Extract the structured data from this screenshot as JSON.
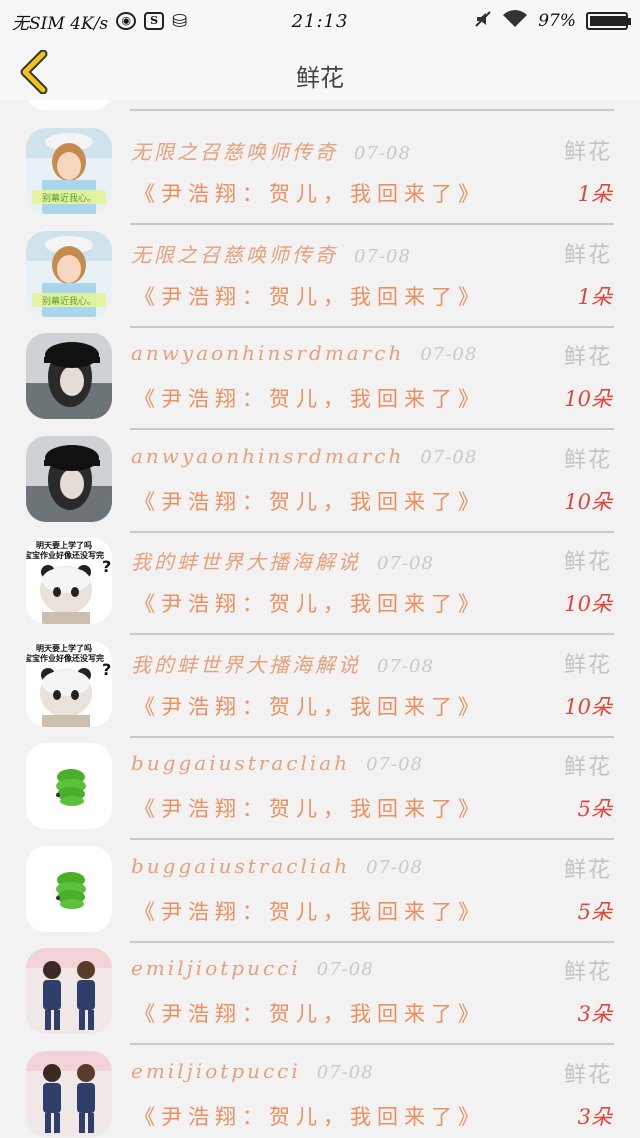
{
  "status_bar": {
    "carrier": "无SIM 4K/s",
    "time": "21:13",
    "battery": "97%",
    "battery_level": 0.97,
    "icons": [
      "globe-icon",
      "s-app-icon",
      "database-icon",
      "mute-icon",
      "wifi-icon",
      "battery-icon"
    ]
  },
  "header": {
    "title": "鲜花",
    "back_icon": "chevron-left-icon",
    "accent": "#f0c21a"
  },
  "colors": {
    "sender": "#e8a07a",
    "message": "#ef8f5e",
    "quantity": "#e0463b",
    "date": "#c9c9c9",
    "gift_label": "#c4c4c4"
  },
  "records": [
    {
      "avatar": "girl-cap-avatar",
      "sender": "无限之召慈唤师传奇",
      "date": "07-08",
      "gift": "鲜花",
      "message": "《尹浩翔：贺儿，我回来了》",
      "quantity": "1朵"
    },
    {
      "avatar": "girl-cap-avatar",
      "sender": "无限之召慈唤师传奇",
      "date": "07-08",
      "gift": "鲜花",
      "message": "《尹浩翔：贺儿，我回来了》",
      "quantity": "1朵"
    },
    {
      "avatar": "black-cap-avatar",
      "sender": "anwyaonhinsrdmarch",
      "date": "07-08",
      "gift": "鲜花",
      "message": "《尹浩翔：贺儿，我回来了》",
      "quantity": "10朵"
    },
    {
      "avatar": "black-cap-avatar",
      "sender": "anwyaonhinsrdmarch",
      "date": "07-08",
      "gift": "鲜花",
      "message": "《尹浩翔：贺儿，我回来了》",
      "quantity": "10朵"
    },
    {
      "avatar": "panda-meme-avatar",
      "sender": "我的蚌世界大播海解说",
      "date": "07-08",
      "gift": "鲜花",
      "message": "《尹浩翔：贺儿，我回来了》",
      "quantity": "10朵"
    },
    {
      "avatar": "panda-meme-avatar",
      "sender": "我的蚌世界大播海解说",
      "date": "07-08",
      "gift": "鲜花",
      "message": "《尹浩翔：贺儿，我回来了》",
      "quantity": "10朵"
    },
    {
      "avatar": "green-worm-avatar",
      "sender": "buggaiustracliah",
      "date": "07-08",
      "gift": "鲜花",
      "message": "《尹浩翔：贺儿，我回来了》",
      "quantity": "5朵"
    },
    {
      "avatar": "green-worm-avatar",
      "sender": "buggaiustracliah",
      "date": "07-08",
      "gift": "鲜花",
      "message": "《尹浩翔：贺儿，我回来了》",
      "quantity": "5朵"
    },
    {
      "avatar": "couple-avatar",
      "sender": "emiljiotpucci",
      "date": "07-08",
      "gift": "鲜花",
      "message": "《尹浩翔：贺儿，我回来了》",
      "quantity": "3朵"
    },
    {
      "avatar": "couple-avatar",
      "sender": "emiljiotpucci",
      "date": "07-08",
      "gift": "鲜花",
      "message": "《尹浩翔：贺儿，我回来了》",
      "quantity": "3朵"
    }
  ],
  "avatar_captions": {
    "girl_cap": "别幕近我心。",
    "panda_line1": "明天要上学了吗",
    "panda_line2": "宝宝作业好像还没写完",
    "panda_mark": "?"
  }
}
